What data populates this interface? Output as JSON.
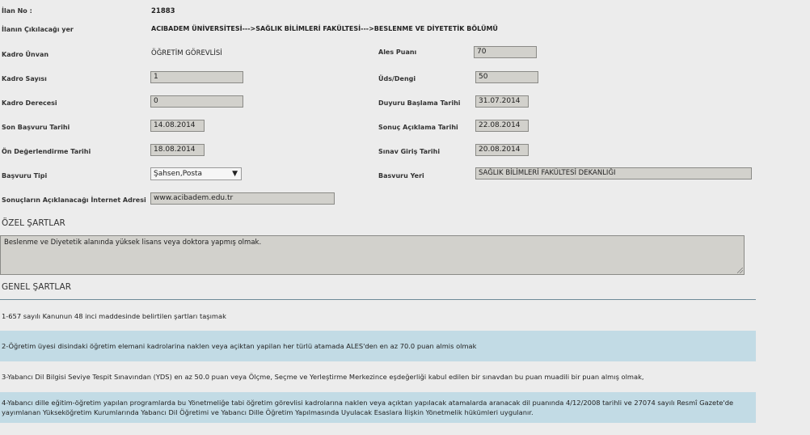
{
  "fields": {
    "ilan_no": {
      "label": "İlan No :",
      "value": "21883"
    },
    "ilanin_cikacagi_yer": {
      "label": "İlanın Çıkılacağı yer",
      "value": "ACIBADEM ÜNİVERSİTESİ--->SAĞLIK BİLİMLERİ FAKÜLTESİ--->BESLENME VE DİYETETİK BÖLÜMÜ"
    },
    "kadro_unvan": {
      "label": "Kadro Ünvan",
      "value": "ÖĞRETİM GÖREVLİSİ"
    },
    "kadro_sayisi": {
      "label": "Kadro Sayısı",
      "value": "1"
    },
    "kadro_derecesi": {
      "label": "Kadro Derecesi",
      "value": "0"
    },
    "son_basvuru_tarihi": {
      "label": "Son Başvuru Tarihi",
      "value": "14.08.2014"
    },
    "on_degerlendirme_tarihi": {
      "label": "Ön Değerlendirme Tarihi",
      "value": "18.08.2014"
    },
    "basvuru_tipi": {
      "label": "Başvuru Tipi",
      "value": "Şahsen,Posta"
    },
    "sonuc_internet_adresi": {
      "label": "Sonuçların Açıklanacağı İnternet Adresi",
      "value": "www.acibadem.edu.tr"
    },
    "ales_puani": {
      "label": "Ales Puanı",
      "value": "70"
    },
    "uds_dengi": {
      "label": "Üds/Dengi",
      "value": "50"
    },
    "duyuru_baslama_tarihi": {
      "label": "Duyuru Başlama Tarihi",
      "value": "31.07.2014"
    },
    "sonuc_aciklama_tarihi": {
      "label": "Sonuç Açıklama Tarihi",
      "value": "22.08.2014"
    },
    "sinav_giris_tarihi": {
      "label": "Sınav Giriş Tarihi",
      "value": "20.08.2014"
    },
    "basvuru_yeri": {
      "label": "Basvuru Yeri",
      "value": "SAĞLIK BİLİMLERİ FAKÜLTESİ DEKANLIĞI"
    }
  },
  "ozel_sartlar": {
    "title": "ÖZEL ŞARTLAR",
    "text": "Beslenme ve Diyetetik alanında yüksek lisans veya doktora yapmış olmak."
  },
  "genel_sartlar": {
    "title": "GENEL ŞARTLAR",
    "items": [
      "1-657 sayılı Kanunun 48 inci maddesinde belirtilen şartları taşımak",
      "2-Öğretim üyesi disindaki öğretim elemani kadrolarina naklen veya açiktan yapilan her türlü atamada ALES'den en az 70.0 puan almis olmak",
      "3-Yabancı Dil Bilgisi Seviye Tespit Sınavından (YDS) en az 50.0 puan veya Ölçme, Seçme ve Yerleştirme Merkezince eşdeğerliği kabul edilen bir sınavdan bu puan muadili bir puan almış olmak,",
      "4-Yabancı dille eğitim-öğretim yapılan programlarda bu Yönetmeliğe tabi öğretim görevlisi kadrolarına naklen veya açıktan yapılacak atamalarda aranacak dil puanında 4/12/2008 tarihli ve 27074 sayılı Resmî Gazete'de yayımlanan Yükseköğretim Kurumlarında Yabancı Dil Öğretimi ve Yabancı Dille Öğretim Yapılmasında Uyulacak Esaslara İlişkin Yönetmelik hükümleri uygulanır."
    ]
  },
  "colors": {
    "background": "#ececec",
    "field_box": "#d2d1cc",
    "highlight_row": "#c2dbe5"
  }
}
